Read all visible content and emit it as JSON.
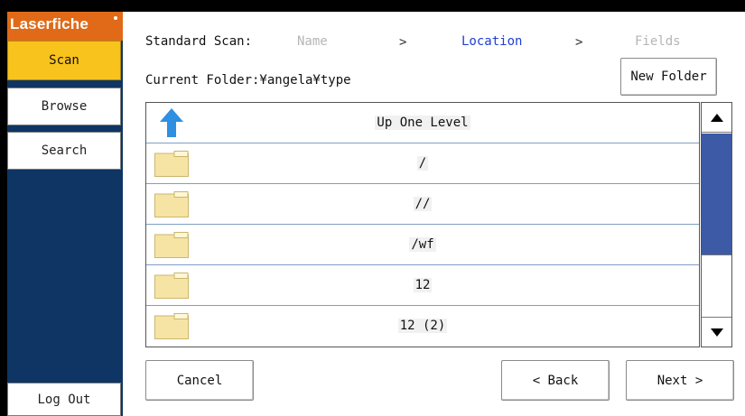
{
  "sidebar": {
    "brand": "Laserfiche",
    "items": [
      {
        "label": "Scan",
        "active": true
      },
      {
        "label": "Browse",
        "active": false
      },
      {
        "label": "Search",
        "active": false
      }
    ],
    "logout_label": "Log Out"
  },
  "steps": {
    "title": "Standard Scan:",
    "items": [
      "Name",
      "Location",
      "Fields"
    ],
    "current": "Location",
    "separator": ">"
  },
  "current_folder": "Current Folder:¥angela¥type",
  "new_folder_label": "New Folder",
  "list": {
    "up_label": "Up One Level",
    "folders": [
      "/",
      "//",
      "/wf",
      "12",
      "12 (2)"
    ]
  },
  "buttons": {
    "cancel": "Cancel",
    "back": "< Back",
    "next": "Next >"
  },
  "colors": {
    "brand": "#e06a17",
    "active_tab": "#f8c31c",
    "sidebar_bg": "#0e3563",
    "current_step": "#1e3fd6",
    "scroll_thumb": "#3c5aa6"
  },
  "icons": {
    "up": "up-arrow-icon",
    "folder": "folder-icon",
    "scroll_up": "triangle-up-icon",
    "scroll_down": "triangle-down-icon"
  }
}
